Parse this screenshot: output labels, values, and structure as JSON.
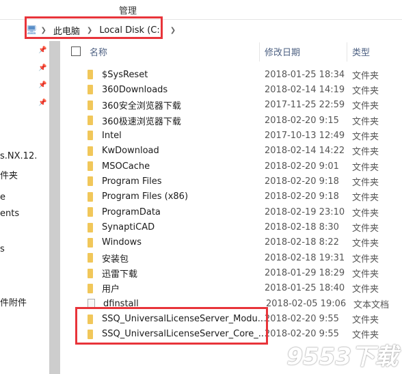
{
  "ribbon": {
    "manage": "管理"
  },
  "address": {
    "crumbs": [
      "此电脑",
      "Local Disk (C:)"
    ]
  },
  "nav": [
    "s.NX.12.",
    "件夹",
    "e",
    "ents",
    "s",
    "件附件"
  ],
  "columns": {
    "name": "名称",
    "date": "修改日期",
    "type": "类型"
  },
  "files": [
    {
      "name": "$SysReset",
      "date": "2018-01-25 18:34",
      "type": "文件夹",
      "icon": "folder"
    },
    {
      "name": "360Downloads",
      "date": "2018-02-14 14:19",
      "type": "文件夹",
      "icon": "folder"
    },
    {
      "name": "360安全浏览器下载",
      "date": "2017-11-25 22:59",
      "type": "文件夹",
      "icon": "folder"
    },
    {
      "name": "360极速浏览器下载",
      "date": "2018-02-20 9:15",
      "type": "文件夹",
      "icon": "folder"
    },
    {
      "name": "Intel",
      "date": "2017-10-13 12:49",
      "type": "文件夹",
      "icon": "folder"
    },
    {
      "name": "KwDownload",
      "date": "2018-02-14 14:22",
      "type": "文件夹",
      "icon": "folder"
    },
    {
      "name": "MSOCache",
      "date": "2018-02-20 9:01",
      "type": "文件夹",
      "icon": "folder"
    },
    {
      "name": "Program Files",
      "date": "2018-02-20 9:18",
      "type": "文件夹",
      "icon": "folder"
    },
    {
      "name": "Program Files (x86)",
      "date": "2018-02-20 9:18",
      "type": "文件夹",
      "icon": "folder"
    },
    {
      "name": "ProgramData",
      "date": "2018-02-19 23:10",
      "type": "文件夹",
      "icon": "folder"
    },
    {
      "name": "SynaptiCAD",
      "date": "2018-02-18 8:30",
      "type": "文件夹",
      "icon": "folder"
    },
    {
      "name": "Windows",
      "date": "2018-02-18 8:22",
      "type": "文件夹",
      "icon": "folder"
    },
    {
      "name": "安装包",
      "date": "2018-02-18 19:31",
      "type": "文件夹",
      "icon": "folder"
    },
    {
      "name": "迅雷下载",
      "date": "2018-01-29 18:29",
      "type": "文件夹",
      "icon": "folder"
    },
    {
      "name": "用户",
      "date": "2018-01-25 18:40",
      "type": "文件夹",
      "icon": "folder"
    },
    {
      "name": "dfinstall",
      "date": "2018-02-05 19:06",
      "type": "文本文档",
      "icon": "text-file"
    },
    {
      "name": "SSQ_UniversalLicenseServer_Modu...",
      "date": "2018-02-20 9:55",
      "type": "文件夹",
      "icon": "folder"
    },
    {
      "name": "SSQ_UniversalLicenseServer_Core_...",
      "date": "2018-02-20 9:55",
      "type": "文件夹",
      "icon": "folder"
    }
  ],
  "watermark": "9553下载",
  "highlight_color": "#e8343a"
}
